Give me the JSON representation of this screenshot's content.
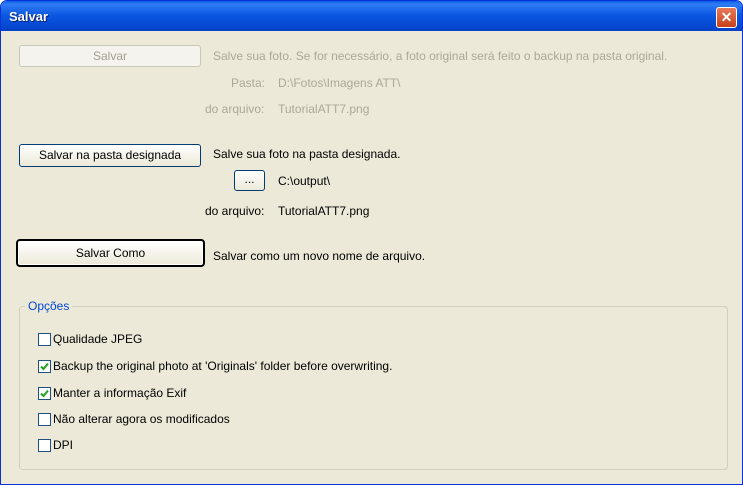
{
  "window": {
    "title": "Salvar",
    "close_glyph": "✕"
  },
  "save": {
    "button_label": "Salvar",
    "description": "Salve sua foto. Se for necessário, a foto original será feito o backup na pasta original.",
    "folder_label": "Pasta:",
    "folder_value": "D:\\Fotos\\Imagens ATT\\",
    "filename_label": "do arquivo:",
    "filename_value": "TutorialATT7.png"
  },
  "save_designated": {
    "button_label": "Salvar na pasta designada",
    "description": "Salve sua foto na pasta designada.",
    "browse_label": "...",
    "folder_value": "C:\\output\\",
    "filename_label": "do arquivo:",
    "filename_value": "TutorialATT7.png"
  },
  "save_as": {
    "button_label": "Salvar Como",
    "description": "Salvar como um novo nome de arquivo."
  },
  "options": {
    "title": "Opções",
    "items": [
      {
        "label": "Qualidade JPEG",
        "checked": false
      },
      {
        "label": "Backup the original photo at 'Originals' folder before overwriting.",
        "checked": true
      },
      {
        "label": "Manter a informação Exif",
        "checked": true
      },
      {
        "label": "Não alterar agora os modificados",
        "checked": false
      },
      {
        "label": "DPI",
        "checked": false
      }
    ]
  },
  "colors": {
    "titlebar": "#0a55e0",
    "face": "#ece9d8",
    "group_title": "#0046d5",
    "disabled_text": "#aca899"
  }
}
